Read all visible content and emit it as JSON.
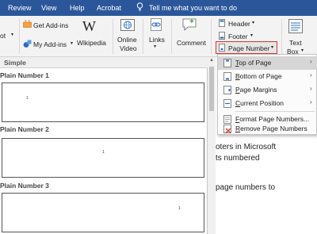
{
  "menubar": {
    "tabs": [
      "Review",
      "View",
      "Help",
      "Acrobat"
    ],
    "tell_me": "Tell me what you want to do"
  },
  "ribbon": {
    "partial_left": "ot",
    "get_addins": "Get Add-ins",
    "my_addins": "My Add-ins",
    "wikipedia": "Wikipedia",
    "online_video_1": "Online",
    "online_video_2": "Video",
    "links": "Links",
    "comment": "Comment",
    "header": "Header",
    "footer": "Footer",
    "page_number": "Page Number",
    "text_box_1": "Text",
    "text_box_2": "Box"
  },
  "gallery": {
    "section": "Simple",
    "items": [
      {
        "label": "Plain Number 1",
        "num": "1"
      },
      {
        "label": "Plain Number 2",
        "num": "1"
      },
      {
        "label": "Plain Number 3",
        "num": "1"
      }
    ]
  },
  "document": {
    "line1": "oters in Microsoft",
    "line2": "ts numbered",
    "line3": "page numbers to"
  },
  "menu": {
    "items": [
      {
        "prefix": "T",
        "rest": "op of Page",
        "submenu": true
      },
      {
        "prefix": "B",
        "rest": "ottom of Page",
        "submenu": true
      },
      {
        "prefix": "P",
        "rest": "age Margins",
        "submenu": true
      },
      {
        "prefix": "C",
        "rest": "urrent Position",
        "submenu": true
      },
      {
        "prefix": "F",
        "rest": "ormat Page Numbers...",
        "submenu": false
      },
      {
        "prefix": "R",
        "rest": "emove Page Numbers",
        "submenu": false
      }
    ]
  },
  "colors": {
    "tabbar": "#2b579a",
    "accent_red": "#d9342b",
    "highlight": "#d6d6d6"
  }
}
